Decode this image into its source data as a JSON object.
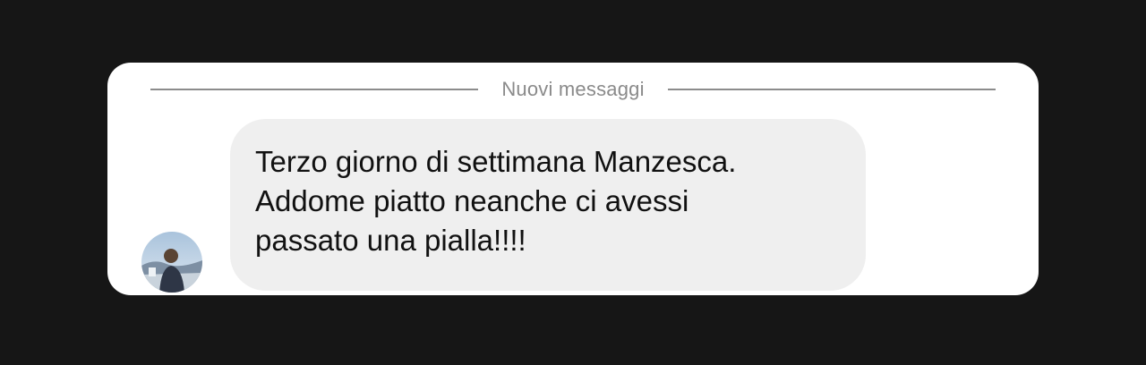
{
  "divider": {
    "label": "Nuovi messaggi"
  },
  "message": {
    "lines": [
      "Terzo giorno di settimana Manzesca.",
      "Addome piatto neanche ci avessi",
      "passato una pialla!!!!"
    ]
  },
  "colors": {
    "background": "#161616",
    "card": "#ffffff",
    "bubble": "#efefef",
    "divider": "#8c8c8c",
    "text": "#111111"
  }
}
